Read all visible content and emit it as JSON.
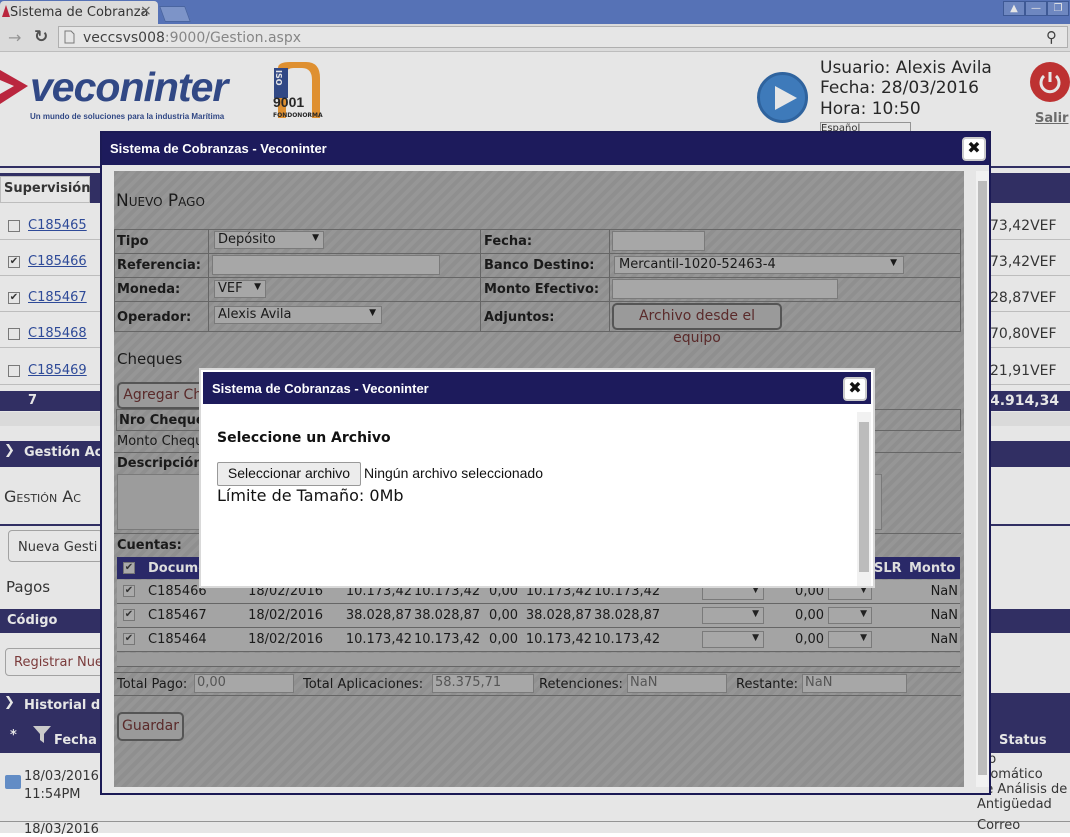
{
  "browser": {
    "tab_title": "Sistema de Cobranza",
    "tab_close": "×",
    "url_host": "veccsvs008",
    "url_rest": ":9000/Gestion.aspx",
    "win_btns": [
      "▲",
      "—",
      "❐"
    ]
  },
  "header": {
    "logo_name": "veconinter",
    "logo_tagline": "Un mundo de soluciones para la industria Marítima",
    "iso_label": "ISO",
    "iso_number": "9001",
    "iso_org": "FONDONORMA",
    "usuario": "Usuario: Alexis Avila",
    "fecha": "Fecha: 28/03/2016",
    "hora": "Hora: 10:50",
    "idioma": "Español",
    "salir": "Salir"
  },
  "background": {
    "tab_supervision": "Supervisión",
    "rows": [
      {
        "code": "C185465",
        "checked": false,
        "amount": "73,42VEF"
      },
      {
        "code": "C185466",
        "checked": true,
        "amount": "73,42VEF"
      },
      {
        "code": "C185467",
        "checked": true,
        "amount": "28,87VEF"
      },
      {
        "code": "C185468",
        "checked": false,
        "amount": "70,80VEF"
      },
      {
        "code": "C185469",
        "checked": false,
        "amount": "21,91VEF"
      }
    ],
    "total_count": "7",
    "total_amount": "4.914,34",
    "gestion_bar": "Gestión Ac",
    "gestion_title": "Gestión Ac",
    "nueva_gestion": "Nueva Gesti",
    "pagos": "Pagos",
    "codigo": "Código",
    "registrar": "Registrar Nue",
    "historial": "Historial de",
    "star": "*",
    "fecha_col": "Fecha",
    "status_col": "Status",
    "hist_date1": "18/03/2016",
    "hist_time1": "11:54PM",
    "hist_date2": "18/03/2016",
    "status_lines": [
      "vío",
      "utomático",
      "de Análisis de",
      "Antigüedad",
      "Correo"
    ]
  },
  "modal1": {
    "title": "Sistema de Cobranzas - Veconinter",
    "close": "✖",
    "heading": "Nuevo Pago",
    "tipo_label": "Tipo",
    "tipo_value": "Depósito",
    "fecha_label": "Fecha:",
    "referencia_label": "Referencia:",
    "banco_label": "Banco Destino:",
    "banco_value": "Mercantil-1020-52463-4",
    "moneda_label": "Moneda:",
    "moneda_value": "VEF",
    "monto_efectivo_label": "Monto Efectivo:",
    "operador_label": "Operador:",
    "operador_value": "Alexis Avila",
    "adjuntos_label": "Adjuntos:",
    "archivo_btn": "Archivo desde el equipo",
    "cheques": "Cheques",
    "agregar_cheque": "Agregar Che",
    "nro_cheque": "Nro Cheque",
    "monto_cheque": "Monto Cheque",
    "descripcion": "Descripción:",
    "cuentas": "Cuentas:",
    "col_documento": "Documen",
    "col_slr": "SLR",
    "col_monto": "Monto",
    "accounts": [
      {
        "doc": "C185466",
        "date": "18/02/2016",
        "a": "10.173,42",
        "b": "10.173,42",
        "c": "0,00",
        "d": "10.173,42",
        "e": "10.173,42",
        "f": "0,00",
        "g": "NaN"
      },
      {
        "doc": "C185467",
        "date": "18/02/2016",
        "a": "38.028,87",
        "b": "38.028,87",
        "c": "0,00",
        "d": "38.028,87",
        "e": "38.028,87",
        "f": "0,00",
        "g": "NaN"
      },
      {
        "doc": "C185464",
        "date": "18/02/2016",
        "a": "10.173,42",
        "b": "10.173,42",
        "c": "0,00",
        "d": "10.173,42",
        "e": "10.173,42",
        "f": "0,00",
        "g": "NaN"
      }
    ],
    "total_pago_label": "Total Pago:",
    "total_pago": "0,00",
    "total_aplic_label": "Total Aplicaciones:",
    "total_aplic": "58.375,71",
    "retenciones_label": "Retenciones:",
    "retenciones": "NaN",
    "restante_label": "Restante:",
    "restante": "NaN",
    "guardar": "Guardar"
  },
  "modal2": {
    "title": "Sistema de Cobranzas - Veconinter",
    "close": "✖",
    "heading": "Seleccione un Archivo",
    "file_button": "Seleccionar archivo",
    "no_file": "Ningún archivo seleccionado",
    "limit": "Límite de Tamaño: 0Mb"
  },
  "colors": {
    "navy": "#1d1b5c",
    "brand_blue": "#1d3a86",
    "logo_red": "#c8102e"
  }
}
